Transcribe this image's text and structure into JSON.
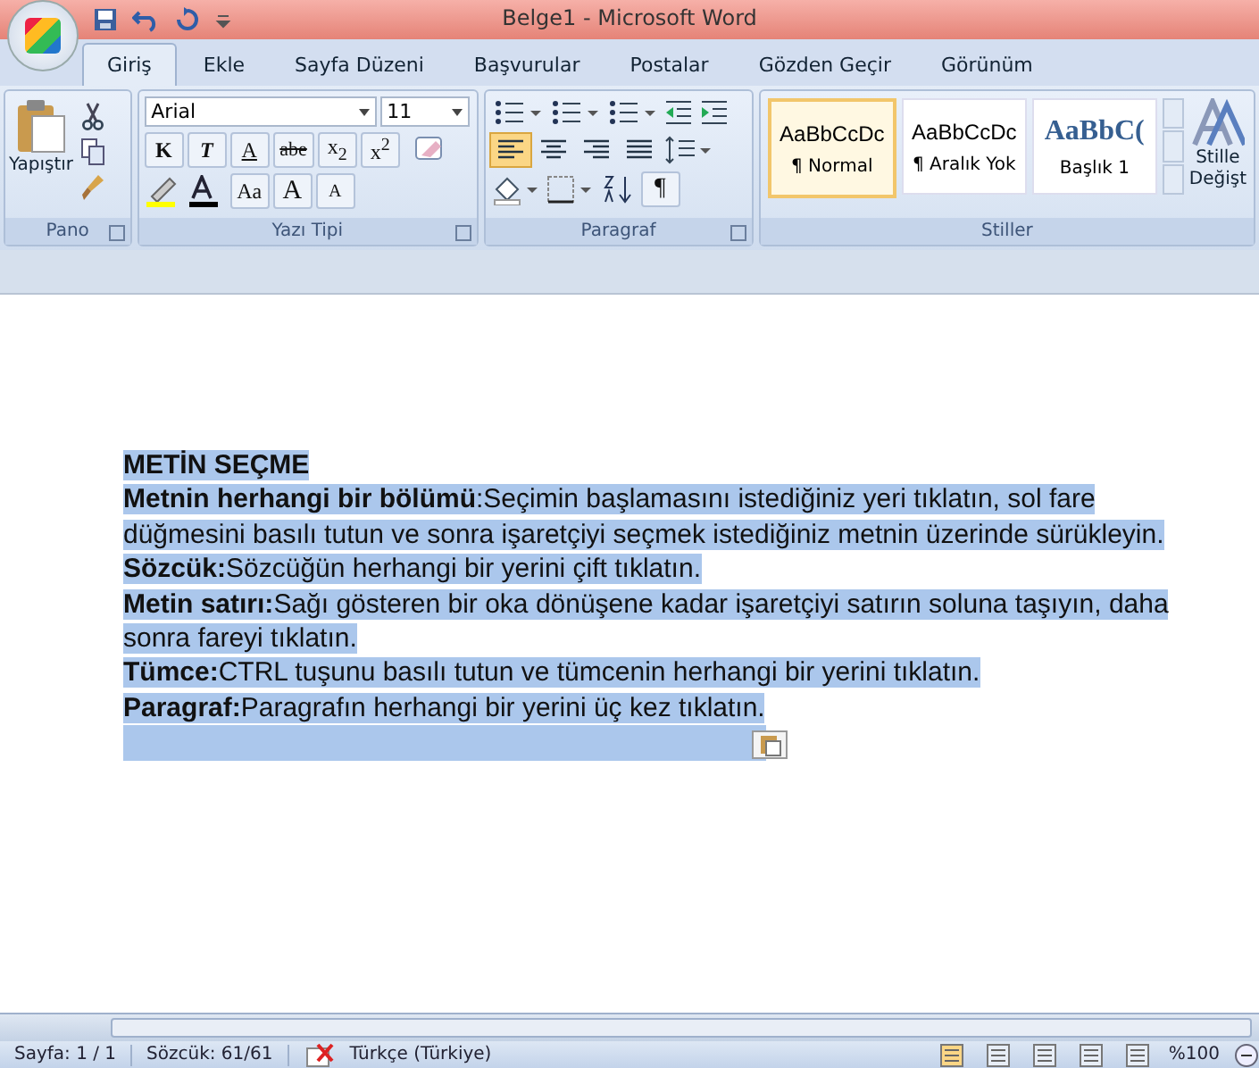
{
  "window": {
    "title": "Belge1 - Microsoft Word"
  },
  "tabs": [
    {
      "label": "Giriş",
      "selected": true
    },
    {
      "label": "Ekle",
      "selected": false
    },
    {
      "label": "Sayfa Düzeni",
      "selected": false
    },
    {
      "label": "Başvurular",
      "selected": false
    },
    {
      "label": "Postalar",
      "selected": false
    },
    {
      "label": "Gözden Geçir",
      "selected": false
    },
    {
      "label": "Görünüm",
      "selected": false
    }
  ],
  "ribbon": {
    "clipboard": {
      "paste_label": "Yapıştır",
      "group_label": "Pano"
    },
    "font": {
      "name": "Arial",
      "size": "11",
      "group_label": "Yazı Tipi",
      "format_buttons": [
        {
          "kind": "bold",
          "label": "K"
        },
        {
          "kind": "italic",
          "label": "T"
        },
        {
          "kind": "underline",
          "label": "A"
        },
        {
          "kind": "strike",
          "label": "abe"
        },
        {
          "kind": "sub",
          "label": "x$_{2}$"
        },
        {
          "kind": "sup",
          "label": "x$^{2}$"
        }
      ],
      "size_buttons": [
        {
          "kind": "case",
          "label": "Aa"
        },
        {
          "kind": "grow",
          "label": "A"
        },
        {
          "kind": "shrink",
          "label": "A"
        }
      ]
    },
    "paragraph": {
      "group_label": "Paragraf",
      "mark_label": "¶",
      "align_buttons": [
        {
          "kind": "left",
          "selected": true
        },
        {
          "kind": "center",
          "selected": false
        },
        {
          "kind": "right",
          "selected": false
        },
        {
          "kind": "justify",
          "selected": false
        }
      ]
    },
    "styles": {
      "group_label": "Stiller",
      "change_label_1": "Stille",
      "change_label_2": "Değişt",
      "items": [
        {
          "preview": "AaBbCcDc",
          "name": "¶ Normal",
          "kind": "body",
          "selected": true
        },
        {
          "preview": "AaBbCcDc",
          "name": "¶ Aralık Yok",
          "kind": "body",
          "selected": false
        },
        {
          "preview": "AaBbC(",
          "name": "Başlık 1",
          "kind": "heading",
          "selected": false
        }
      ]
    }
  },
  "document": {
    "selected": true,
    "heading": "METİN SEÇME",
    "paragraphs": [
      "**Metnin herhangi bir bölümü**:Seçimin başlamasını istediğiniz yeri tıklatın, sol fare düğmesini basılı tutun ve sonra işaretçiyi seçmek istediğiniz metnin üzerinde sürükleyin.",
      "**Sözcük:**Sözcüğün herhangi bir yerini çift tıklatın.",
      "**Metin satırı:**Sağı gösteren bir oka dönüşene kadar işaretçiyi satırın soluna taşıyın, daha sonra fareyi tıklatın.",
      "**Tümce:**CTRL tuşunu basılı tutun ve tümcenin herhangi bir yerini tıklatın.",
      "**Paragraf:**Paragrafın herhangi bir yerini üç kez tıklatın."
    ]
  },
  "status_bar": {
    "page": "Sayfa: 1 / 1",
    "words": "Sözcük: 61/61",
    "language": "Türkçe (Türkiye)",
    "zoom": "%100"
  }
}
